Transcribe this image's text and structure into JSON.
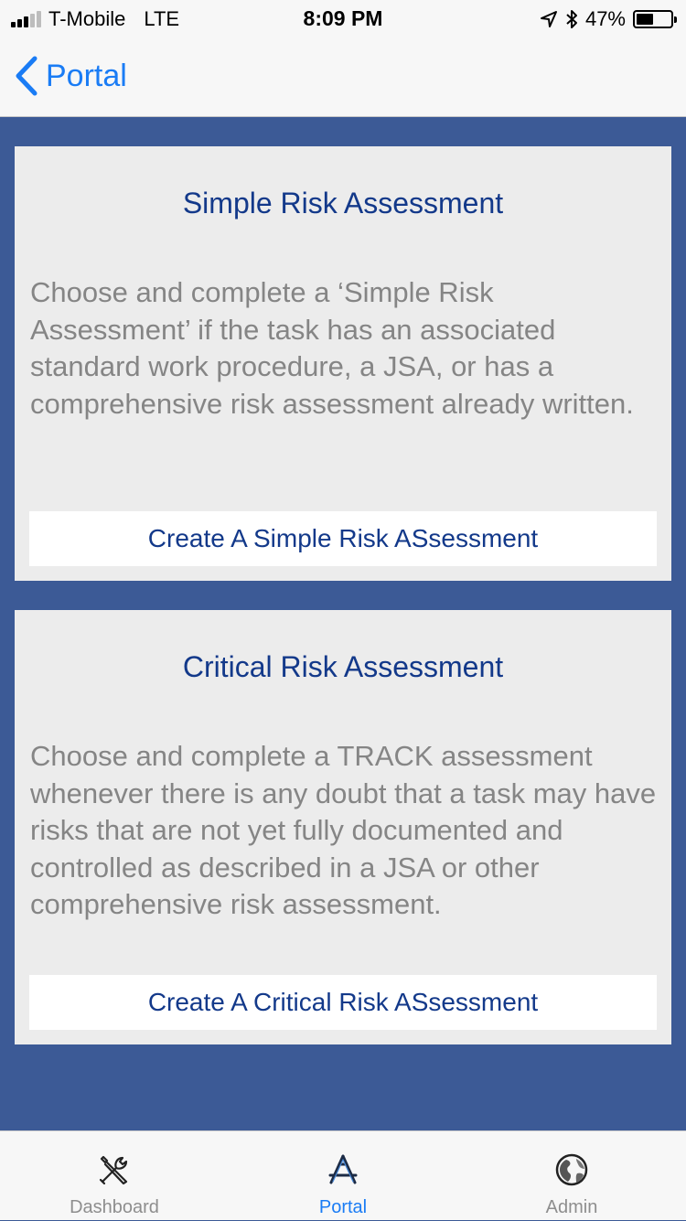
{
  "status_bar": {
    "carrier": "T-Mobile",
    "network": "LTE",
    "time": "8:09 PM",
    "battery_percent": "47%",
    "battery_level": 0.47,
    "signal_bars": 3
  },
  "nav": {
    "back_label": "Portal"
  },
  "cards": [
    {
      "title": "Simple Risk Assessment",
      "description": "Choose and complete a ‘Simple Risk Assessment’ if the task has an associated standard work procedure, a JSA, or has a comprehensive risk assessment already written.",
      "button_label": "Create A Simple Risk ASsessment"
    },
    {
      "title": "Critical Risk Assessment",
      "description": "Choose and complete a TRACK assessment whenever there is any doubt that a task may have risks that are not yet fully documented and controlled as described in a JSA or other comprehensive risk assessment.",
      "button_label": "Create A Critical Risk ASsessment"
    }
  ],
  "tab_bar": {
    "items": [
      {
        "label": "Dashboard",
        "icon": "tools-icon",
        "active": false
      },
      {
        "label": "Portal",
        "icon": "app-store-icon",
        "active": true
      },
      {
        "label": "Admin",
        "icon": "globe-icon",
        "active": false
      }
    ]
  },
  "colors": {
    "background": "#3c5a96",
    "card": "#ececec",
    "title": "#13398a",
    "accent": "#1a7cf5"
  }
}
